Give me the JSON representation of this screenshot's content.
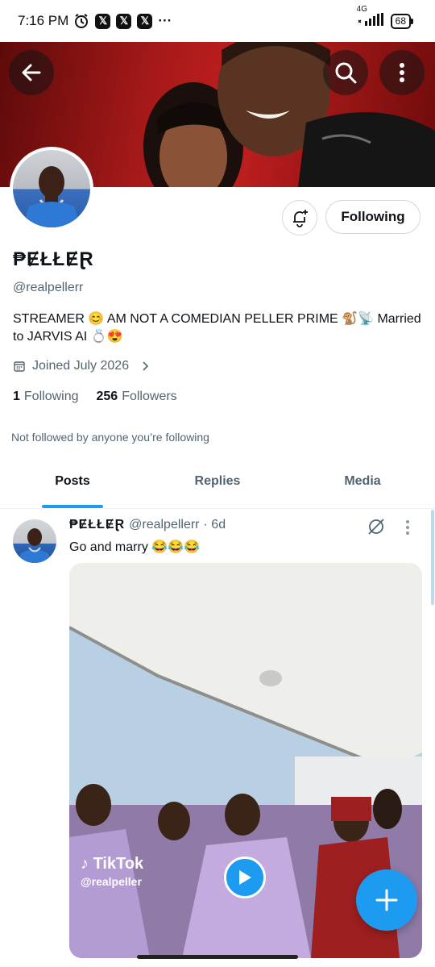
{
  "status_bar": {
    "time": "7:16 PM",
    "notif_badges": [
      "𝕏",
      "𝕏",
      "𝕏"
    ],
    "overflow": "···",
    "network": "4G",
    "battery": "68"
  },
  "header": {
    "back_icon": "arrow-left-icon",
    "search_icon": "search-icon",
    "more_icon": "more-vertical-icon"
  },
  "profile": {
    "display_name": "₱ɆŁŁɆⱤ",
    "handle": "@realpellerr",
    "bio": "STREAMER 😊 AM NOT A COMEDIAN PELLER PRIME 🐒📡 Married to JARVIS AI 💍😍",
    "joined": "Joined July 2026",
    "following_count": "1",
    "following_label": "Following",
    "followers_count": "256",
    "followers_label": "Followers",
    "not_followed_text": "Not followed by anyone you’re following",
    "follow_button_label": "Following"
  },
  "tabs": [
    {
      "label": "Posts",
      "active": true
    },
    {
      "label": "Replies",
      "active": false
    },
    {
      "label": "Media",
      "active": false
    }
  ],
  "post": {
    "author_name": "₱ɆŁŁɆⱤ",
    "author_handle": "@realpellerr",
    "age": "· 6d",
    "text": "Go and marry 😂😂😂",
    "media": {
      "watermark_brand": "TikTok",
      "watermark_handle": "@realpeller"
    }
  },
  "colors": {
    "accent": "#1d9bf0",
    "banner_red": "#b31b1b",
    "text_primary": "#0f1419",
    "text_secondary": "#536471"
  }
}
